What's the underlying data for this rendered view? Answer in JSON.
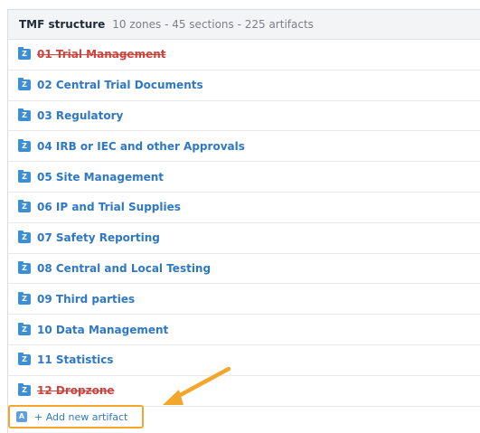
{
  "header": {
    "title": "TMF structure",
    "summary": "10 zones - 45 sections - 225 artifacts"
  },
  "zones": [
    {
      "icon_letter": "Z",
      "label": "01 Trial Management",
      "deleted": true
    },
    {
      "icon_letter": "Z",
      "label": "02 Central Trial Documents",
      "deleted": false
    },
    {
      "icon_letter": "Z",
      "label": "03 Regulatory",
      "deleted": false
    },
    {
      "icon_letter": "Z",
      "label": "04 IRB or IEC and other Approvals",
      "deleted": false
    },
    {
      "icon_letter": "Z",
      "label": "05 Site Management",
      "deleted": false
    },
    {
      "icon_letter": "Z",
      "label": "06 IP and Trial Supplies",
      "deleted": false
    },
    {
      "icon_letter": "Z",
      "label": "07 Safety Reporting",
      "deleted": false
    },
    {
      "icon_letter": "Z",
      "label": "08 Central and Local Testing",
      "deleted": false
    },
    {
      "icon_letter": "Z",
      "label": "09 Third parties",
      "deleted": false
    },
    {
      "icon_letter": "Z",
      "label": "10 Data Management",
      "deleted": false
    },
    {
      "icon_letter": "Z",
      "label": "11 Statistics",
      "deleted": false
    },
    {
      "icon_letter": "Z",
      "label": "12 Dropzone",
      "deleted": true
    }
  ],
  "add_artifact": {
    "icon_letter": "A",
    "label": "+ Add new artifact"
  },
  "colors": {
    "link": "#2f78c4",
    "deleted": "#d0413b",
    "highlight": "#f2a62a",
    "zone_icon": "#3d8fd4"
  }
}
